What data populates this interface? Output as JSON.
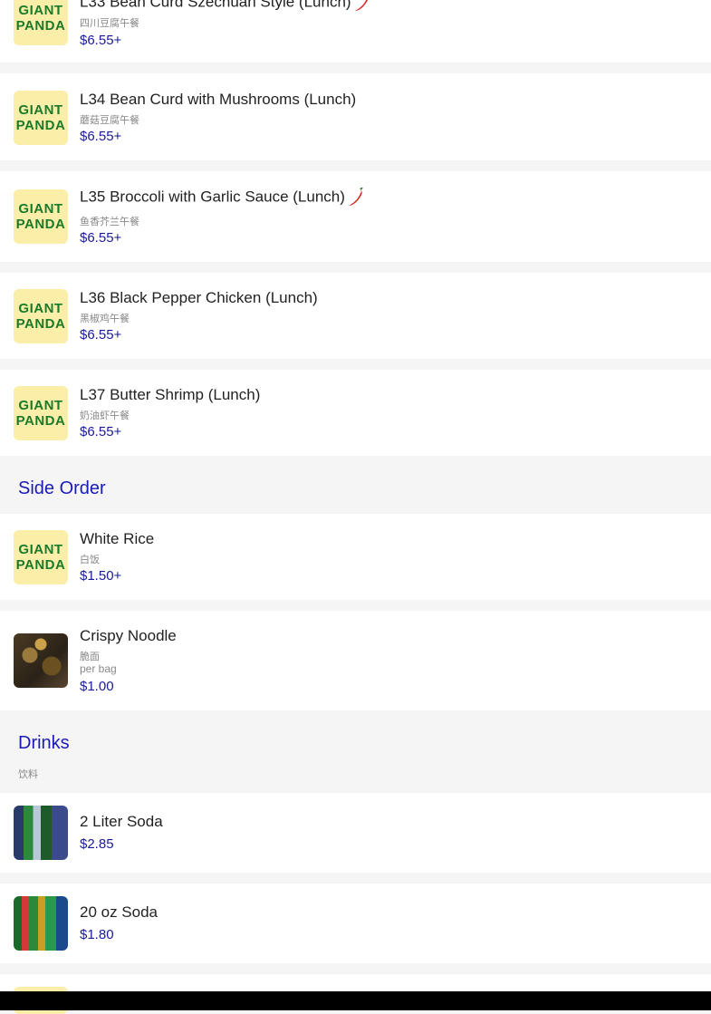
{
  "logo": {
    "line1": "GIANT",
    "line2": "PANDA"
  },
  "sections": {
    "side_order": {
      "title": "Side Order"
    },
    "drinks": {
      "title": "Drinks",
      "subtitle": "饮料"
    }
  },
  "items": [
    {
      "name": "L33 Bean Curd Szechuan Style (Lunch)",
      "sub": "四川豆腐午餐",
      "price": "$6.55+",
      "spicy": true,
      "thumb": "logo"
    },
    {
      "name": "L34 Bean Curd with Mushrooms (Lunch)",
      "sub": "蘑菇豆腐午餐",
      "price": "$6.55+",
      "spicy": false,
      "thumb": "logo"
    },
    {
      "name": "L35 Broccoli with Garlic Sauce (Lunch)",
      "sub": "鱼香芥兰午餐",
      "price": "$6.55+",
      "spicy": true,
      "thumb": "logo"
    },
    {
      "name": "L36 Black Pepper Chicken (Lunch)",
      "sub": "黑椒鸡午餐",
      "price": "$6.55+",
      "spicy": false,
      "thumb": "logo"
    },
    {
      "name": "L37 Butter Shrimp (Lunch)",
      "sub": "奶油虾午餐",
      "price": "$6.55+",
      "spicy": false,
      "thumb": "logo"
    },
    {
      "name": "White Rice",
      "sub": "白饭",
      "price": "$1.50+",
      "spicy": false,
      "thumb": "logo"
    },
    {
      "name": "Crispy Noodle",
      "sub": "脆面",
      "note": "per bag",
      "price": "$1.00",
      "spicy": false,
      "thumb": "photo-noodle"
    },
    {
      "name": "2 Liter Soda",
      "price": "$2.85",
      "spicy": false,
      "thumb": "photo-soda1"
    },
    {
      "name": "20 oz Soda",
      "price": "$1.80",
      "spicy": false,
      "thumb": "photo-soda2"
    }
  ]
}
